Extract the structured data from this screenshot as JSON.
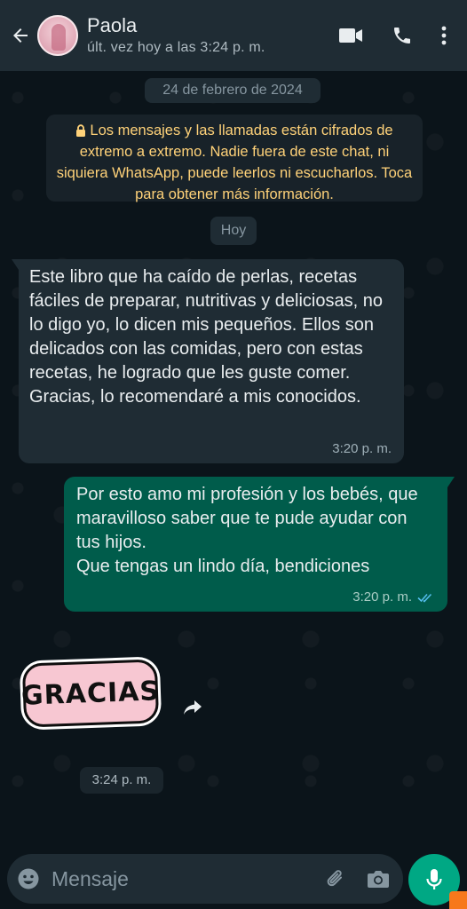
{
  "header": {
    "contact_name": "Paola",
    "last_seen": "últ. vez hoy a las 3:24 p. m.",
    "icons": [
      "back-arrow-icon",
      "video-call-icon",
      "voice-call-icon",
      "more-options-icon"
    ]
  },
  "chat": {
    "date_chip": "24 de febrero de 2024",
    "encryption_notice": "Los mensajes y las llamadas están cifrados de extremo a extremo. Nadie fuera de este chat, ni siquiera WhatsApp, puede leerlos ni escucharlos. Toca para obtener más información.",
    "today_chip": "Hoy",
    "messages": [
      {
        "direction": "incoming",
        "text": "Este libro que ha caído de perlas, recetas fáciles de preparar, nutritivas y deliciosas, no lo digo yo, lo dicen mis pequeños. Ellos son delicados con las comidas, pero con estas recetas, he logrado que les guste comer.\nGracias, lo recomendaré a mis conocidos.",
        "time": "3:20 p. m."
      },
      {
        "direction": "outgoing",
        "text": "Por esto amo mi profesión y los bebés, que maravilloso saber que te pude ayudar con tus hijos.\nQue tengas un lindo día, bendiciones",
        "time": "3:20 p. m.",
        "status": "read"
      },
      {
        "direction": "incoming",
        "type": "sticker",
        "sticker_text": "GRACIAS",
        "time": "3:24 p. m."
      }
    ]
  },
  "composer": {
    "placeholder": "Mensaje"
  },
  "colors": {
    "header_bg": "#1f2c34",
    "chat_bg": "#0b141a",
    "incoming_bubble": "#1f2c34",
    "outgoing_bubble": "#005c4b",
    "accent": "#00a884",
    "notice_text": "#ffd279",
    "read_ticks": "#53bdeb"
  }
}
